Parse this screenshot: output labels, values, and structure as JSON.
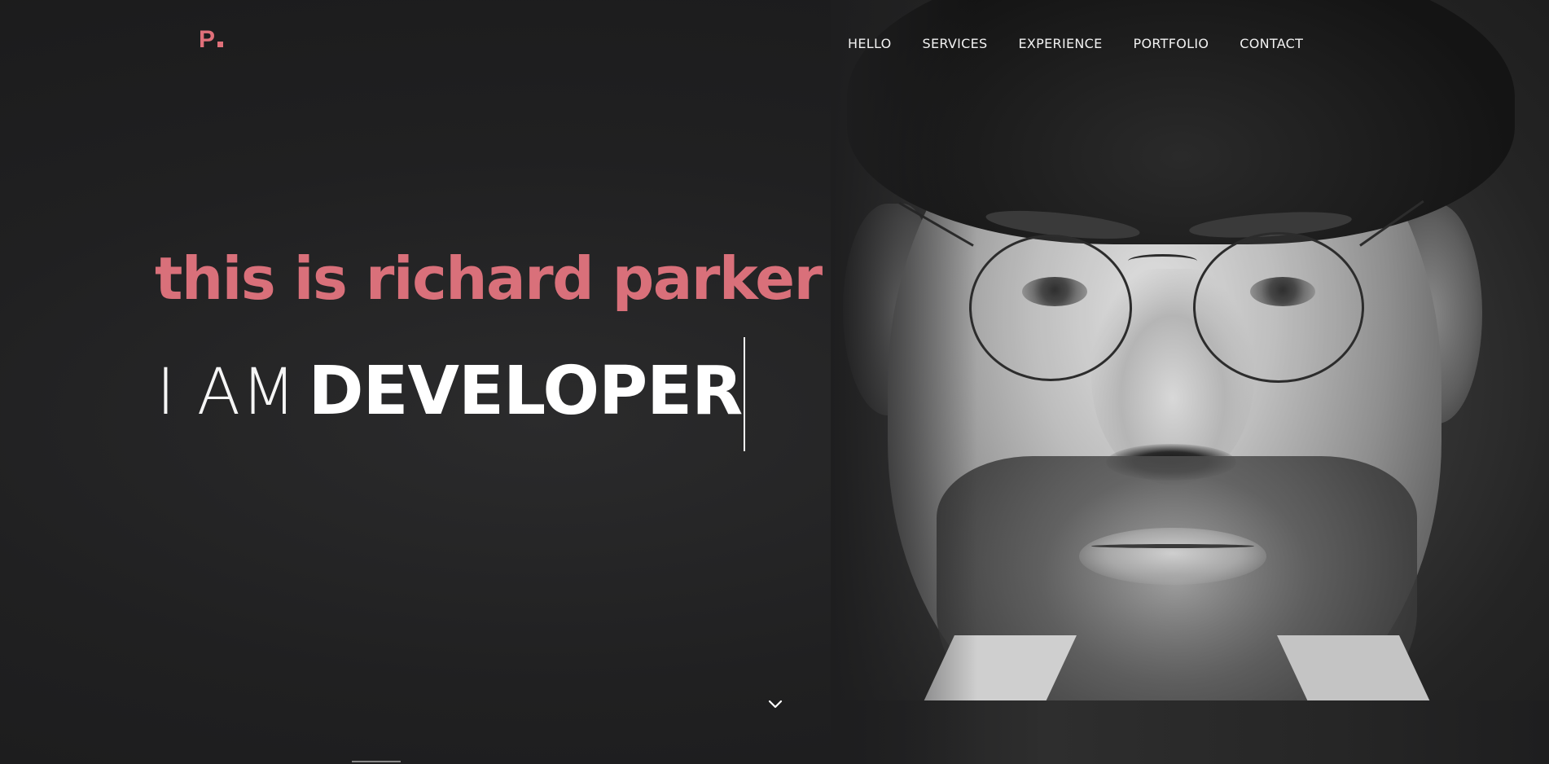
{
  "brand": {
    "logo_letter": "P",
    "accent_color": "#e0707a"
  },
  "nav": {
    "items": [
      {
        "label": "HELLO"
      },
      {
        "label": "SERVICES"
      },
      {
        "label": "EXPERIENCE"
      },
      {
        "label": "PORTFOLIO"
      },
      {
        "label": "CONTACT"
      }
    ]
  },
  "hero": {
    "headline": "this is richard parker",
    "prefix": "I AM",
    "role": "DEVELOPER",
    "scroll_icon": "chevron-down-icon",
    "portrait_icon": "portrait-photo"
  },
  "colors": {
    "background": "#1c1c1d",
    "headline": "#d9707a",
    "text": "#ffffff"
  }
}
